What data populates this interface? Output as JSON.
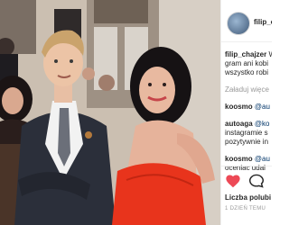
{
  "post": {
    "username": "filip_chajzer",
    "header_username": "filip_c",
    "caption_lines": [
      {
        "user": "filip_chajzer",
        "text": "W"
      },
      {
        "text": "gram ani kobi"
      },
      {
        "text": "wszystko robi"
      }
    ],
    "load_more": "Załaduj więce",
    "comments": [
      {
        "user": "koosmo",
        "mention": "@au",
        "lines": []
      },
      {
        "user": "autoaga",
        "mention": "@ko",
        "lines": [
          "instagramie s",
          "pozytywnie in"
        ]
      },
      {
        "user": "koosmo",
        "mention": "@au",
        "lines": [
          "oceniac udal"
        ]
      }
    ],
    "likes_label": "Liczba polubi",
    "timestamp": "1 DZIEŃ TEMU"
  },
  "colors": {
    "heart": "#ed4956",
    "dress": "#e8341c",
    "suit": "#2b2f3a"
  }
}
